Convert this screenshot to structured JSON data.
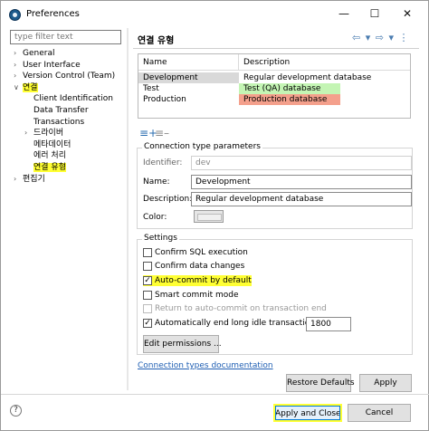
{
  "window": {
    "title": "Preferences",
    "behind_text": "...",
    "controls": [
      "—",
      "☐",
      "✕"
    ]
  },
  "filter": {
    "placeholder": "type filter text"
  },
  "tree": [
    {
      "label": "General",
      "twisty": "›",
      "indent": 0,
      "highlight": false
    },
    {
      "label": "User Interface",
      "twisty": "›",
      "indent": 0,
      "highlight": false
    },
    {
      "label": "Version Control (Team)",
      "twisty": "›",
      "indent": 0,
      "highlight": false
    },
    {
      "label": "연결",
      "twisty": "∨",
      "indent": 0,
      "highlight": true
    },
    {
      "label": "Client Identification",
      "twisty": "",
      "indent": 1,
      "highlight": false
    },
    {
      "label": "Data Transfer",
      "twisty": "",
      "indent": 1,
      "highlight": false
    },
    {
      "label": "Transactions",
      "twisty": "",
      "indent": 1,
      "highlight": false
    },
    {
      "label": "드라이버",
      "twisty": "›",
      "indent": 1,
      "highlight": false
    },
    {
      "label": "메타데이터",
      "twisty": "",
      "indent": 1,
      "highlight": false
    },
    {
      "label": "에러 처리",
      "twisty": "",
      "indent": 1,
      "highlight": false
    },
    {
      "label": "연결 유형",
      "twisty": "",
      "indent": 1,
      "highlight": true
    },
    {
      "label": "편집기",
      "twisty": "›",
      "indent": 0,
      "highlight": false
    }
  ],
  "page": {
    "title": "연결 유형",
    "nav_icons": "⇦ ▾ ⇨ ▾ ⋮"
  },
  "table": {
    "headers": [
      "Name",
      "Description"
    ],
    "rows": [
      {
        "name": "Development",
        "description": "Regular development database",
        "desc_color": "#ffffff",
        "selected": true
      },
      {
        "name": "Test",
        "description": "Test (QA) database",
        "desc_color": "#c4f5b4",
        "selected": false
      },
      {
        "name": "Production",
        "description": "Production database",
        "desc_color": "#f4a08c",
        "selected": false
      }
    ]
  },
  "table_buttons": {
    "add": "≡+",
    "remove": "≡–"
  },
  "params": {
    "title": "Connection type parameters",
    "identifier_label": "Identifier:",
    "identifier_value": "dev",
    "name_label": "Name:",
    "name_value": "Development",
    "description_label": "Description:",
    "description_value": "Regular development database",
    "color_label": "Color:"
  },
  "settings": {
    "title": "Settings",
    "checks": [
      {
        "label": "Confirm SQL execution",
        "checked": false,
        "disabled": false,
        "highlight": false
      },
      {
        "label": "Confirm data changes",
        "checked": false,
        "disabled": false,
        "highlight": false
      },
      {
        "label": "Auto-commit by default",
        "checked": true,
        "disabled": false,
        "highlight": true
      },
      {
        "label": "Smart commit mode",
        "checked": false,
        "disabled": false,
        "highlight": false
      },
      {
        "label": "Return to auto-commit on transaction end",
        "checked": false,
        "disabled": true,
        "highlight": false
      },
      {
        "label": "Automatically end long idle transactions",
        "checked": true,
        "disabled": false,
        "highlight": false
      }
    ],
    "idle_value": "1800",
    "edit_permissions": "Edit permissions ..."
  },
  "link": "Connection types documentation",
  "buttons": {
    "restore": "Restore Defaults",
    "apply": "Apply",
    "apply_close": "Apply and Close",
    "cancel": "Cancel"
  },
  "colors": {
    "highlight": "#ffff33",
    "link": "#1f5fb3",
    "selected_row": "#d9d9d9"
  }
}
